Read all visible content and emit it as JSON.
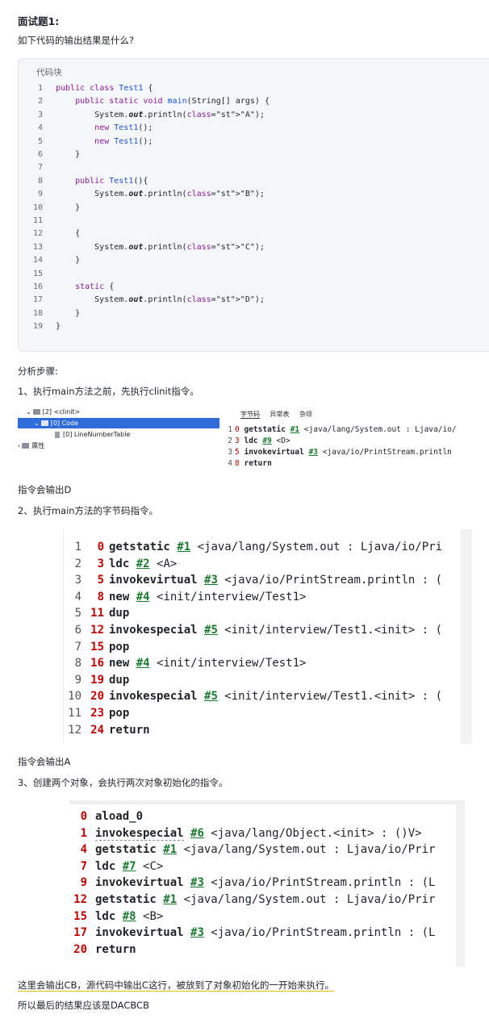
{
  "title": "面试题1:",
  "question": "如下代码的输出结果是什么?",
  "code_block": {
    "caption": "代码块",
    "lines": [
      "public class Test1 {",
      "    public static void main(String[] args) {",
      "        System.out.println(\"A\");",
      "        new Test1();",
      "        new Test1();",
      "    }",
      "",
      "    public Test1(){",
      "        System.out.println(\"B\");",
      "    }",
      "",
      "    {",
      "        System.out.println(\"C\");",
      "    }",
      "",
      "    static {",
      "        System.out.println(\"D\");",
      "    }",
      "}"
    ]
  },
  "analysis_label": "分析步骤:",
  "step1": "1、执行main方法之前，先执行clinit指令。",
  "tree": {
    "items": [
      "[2] <clinit>",
      "[0] Code",
      "[0] LineNumberTable",
      "属性"
    ]
  },
  "bytecode_tabs": [
    "字节码",
    "异常表",
    "杂项"
  ],
  "clinit_bytecode": [
    {
      "ln": "1",
      "off": "0",
      "op": "getstatic",
      "ref": "#1",
      "rest": " <java/lang/System.out : Ljava/io/"
    },
    {
      "ln": "2",
      "off": "3",
      "op": "ldc",
      "ref": "#9",
      "rest": " <D>"
    },
    {
      "ln": "3",
      "off": "5",
      "op": "invokevirtual",
      "ref": "#3",
      "rest": " <java/io/PrintStream.println"
    },
    {
      "ln": "4",
      "off": "8",
      "op": "return",
      "ref": "",
      "rest": ""
    }
  ],
  "output_d": "指令会输出D",
  "step2": "2、执行main方法的字节码指令。",
  "main_bytecode": [
    {
      "ln": "1",
      "off": "0",
      "op": "getstatic",
      "ref": "#1",
      "rest": " <java/lang/System.out : Ljava/io/Pri"
    },
    {
      "ln": "2",
      "off": "3",
      "op": "ldc",
      "ref": "#2",
      "rest": " <A>"
    },
    {
      "ln": "3",
      "off": "5",
      "op": "invokevirtual",
      "ref": "#3",
      "rest": " <java/io/PrintStream.println : ("
    },
    {
      "ln": "4",
      "off": "8",
      "op": "new",
      "ref": "#4",
      "rest": " <init/interview/Test1>"
    },
    {
      "ln": "5",
      "off": "11",
      "op": "dup",
      "ref": "",
      "rest": ""
    },
    {
      "ln": "6",
      "off": "12",
      "op": "invokespecial",
      "ref": "#5",
      "rest": " <init/interview/Test1.<init> : ("
    },
    {
      "ln": "7",
      "off": "15",
      "op": "pop",
      "ref": "",
      "rest": ""
    },
    {
      "ln": "8",
      "off": "16",
      "op": "new",
      "ref": "#4",
      "rest": " <init/interview/Test1>"
    },
    {
      "ln": "9",
      "off": "19",
      "op": "dup",
      "ref": "",
      "rest": ""
    },
    {
      "ln": "10",
      "off": "20",
      "op": "invokespecial",
      "ref": "#5",
      "rest": " <init/interview/Test1.<init> : ("
    },
    {
      "ln": "11",
      "off": "23",
      "op": "pop",
      "ref": "",
      "rest": ""
    },
    {
      "ln": "12",
      "off": "24",
      "op": "return",
      "ref": "",
      "rest": ""
    }
  ],
  "output_a": "指令会输出A",
  "step3": "3、创建两个对象，会执行两次对象初始化的指令。",
  "init_bytecode": [
    {
      "off": "0",
      "op": "aload_0",
      "ref": "",
      "rest": ""
    },
    {
      "off": "1",
      "op": "invokespecial",
      "ref": "#6",
      "rest": " <java/lang/Object.<init> : ()V>"
    },
    {
      "off": "4",
      "op": "getstatic",
      "ref": "#1",
      "rest": " <java/lang/System.out : Ljava/io/Prir"
    },
    {
      "off": "7",
      "op": "ldc",
      "ref": "#7",
      "rest": " <C>"
    },
    {
      "off": "9",
      "op": "invokevirtual",
      "ref": "#3",
      "rest": " <java/io/PrintStream.println : (L"
    },
    {
      "off": "12",
      "op": "getstatic",
      "ref": "#1",
      "rest": " <java/lang/System.out : Ljava/io/Prir"
    },
    {
      "off": "15",
      "op": "ldc",
      "ref": "#8",
      "rest": " <B>"
    },
    {
      "off": "17",
      "op": "invokevirtual",
      "ref": "#3",
      "rest": " <java/io/PrintStream.println : (L"
    },
    {
      "off": "20",
      "op": "return",
      "ref": "",
      "rest": ""
    }
  ],
  "explain": "这里会输出CB，源代码中输出C这行，被放到了对象初始化的一开始来执行。",
  "conclusion": "所以最后的结果应该是DACBCB",
  "colors": {
    "keyword": "#8a1b99",
    "name": "#2154d6",
    "offset": "#c00000",
    "ref": "#1a7b2f",
    "selected": "#2f6bd9"
  }
}
